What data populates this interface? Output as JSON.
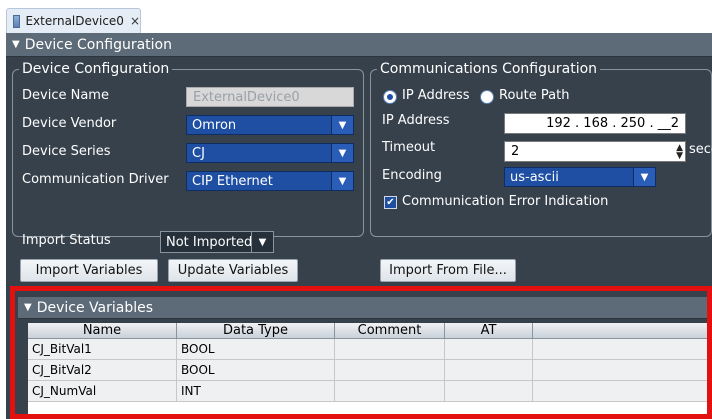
{
  "tab": {
    "label": "ExternalDevice0",
    "close_glyph": "×",
    "icon": "device-icon"
  },
  "device_configuration": {
    "section_title": "Device Configuration",
    "group_title": "Device Configuration",
    "device_name": {
      "label": "Device Name",
      "value": "ExternalDevice0"
    },
    "device_vendor": {
      "label": "Device Vendor",
      "value": "Omron"
    },
    "device_series": {
      "label": "Device Series",
      "value": "CJ"
    },
    "communication_driver": {
      "label": "Communication Driver",
      "value": "CIP Ethernet"
    }
  },
  "communications": {
    "group_title": "Communications Configuration",
    "ip_address_option": "IP Address",
    "route_path_option": "Route Path",
    "selected_option": "IP Address",
    "ip_address": {
      "label": "IP Address",
      "value": "192 . 168 . 250 . __2"
    },
    "timeout": {
      "label": "Timeout",
      "value": "2",
      "unit": "seconds"
    },
    "encoding": {
      "label": "Encoding",
      "value": "us-ascii"
    },
    "error_indication": {
      "label": "Communication Error Indication",
      "checked": true
    }
  },
  "import": {
    "status_label": "Import Status",
    "status_value": "Not Imported.",
    "import_variables": "Import Variables",
    "update_variables": "Update Variables",
    "import_from_file": "Import From File..."
  },
  "device_variables": {
    "section_title": "Device Variables",
    "columns": [
      "Name",
      "Data Type",
      "Comment",
      "AT",
      ""
    ],
    "rows": [
      {
        "name": "CJ_BitVal1",
        "type": "BOOL",
        "comment": "",
        "at": ""
      },
      {
        "name": "CJ_BitVal2",
        "type": "BOOL",
        "comment": "",
        "at": ""
      },
      {
        "name": "CJ_NumVal",
        "type": "INT",
        "comment": "",
        "at": ""
      }
    ]
  },
  "colors": {
    "highlight": "#e31010",
    "accent": "#1e4fa3",
    "panel": "#37414c"
  }
}
